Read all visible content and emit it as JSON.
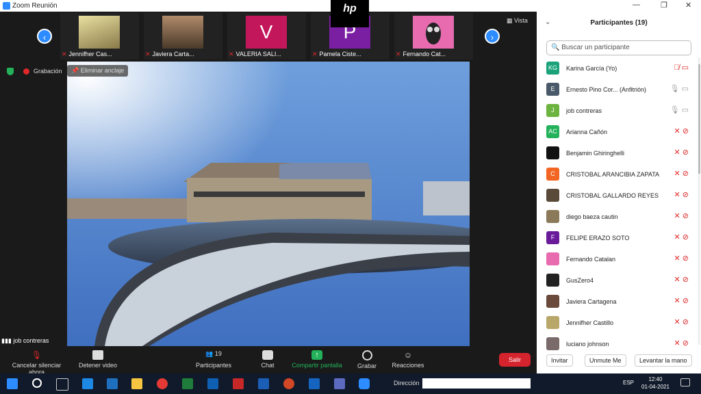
{
  "window": {
    "title": "Zoom Reunión"
  },
  "strip": {
    "view_label": "Vista",
    "thumbnails": [
      {
        "name": "Jennifher Cas...",
        "letter": "",
        "color": "#b9a76a"
      },
      {
        "name": "Javiera Carta...",
        "letter": "",
        "color": "#6a4a3a"
      },
      {
        "name": "VALERIA SALI...",
        "letter": "V",
        "color": "#c2185b"
      },
      {
        "name": "Pamela Ciste...",
        "letter": "P",
        "color": "#7b1fa2"
      },
      {
        "name": "Fernando Cat...",
        "letter": "",
        "color": "#e86bb0"
      }
    ],
    "sharing_logo": "hp"
  },
  "meeting": {
    "recording_label": "Grabación",
    "unpin_label": "Eliminar anclaje",
    "active_speaker": "job contreras"
  },
  "toolbar": {
    "mute": "Cancelar silenciar ahora",
    "video": "Detener video",
    "participants": "Participantes",
    "participants_count": "19",
    "chat": "Chat",
    "share": "Compartir pantalla",
    "record": "Grabar",
    "reactions": "Reacciones",
    "leave": "Salir"
  },
  "panel": {
    "title": "Participantes (19)",
    "search_placeholder": "Buscar un participante",
    "participants": [
      {
        "initials": "KG",
        "name": "Karina García (Yo)",
        "color": "#1aa37a",
        "mic": "muted",
        "video": "on"
      },
      {
        "initials": "E",
        "name": "Ernesto Pino Cor... (Anfitrión)",
        "color": "#4a5a6a",
        "mic": "on",
        "video": "on"
      },
      {
        "initials": "J",
        "name": "job contreras",
        "color": "#6db33f",
        "mic": "on",
        "video": "on"
      },
      {
        "initials": "AC",
        "name": "Arianna Cañón",
        "color": "#23b25b",
        "mic": "muted",
        "video": "off"
      },
      {
        "initials": "",
        "name": "Benjamin Ghiringhelli",
        "color": "#111111",
        "mic": "muted",
        "video": "off"
      },
      {
        "initials": "C",
        "name": "CRISTOBAL ARANCIBIA ZAPATA",
        "color": "#f26522",
        "mic": "muted",
        "video": "off"
      },
      {
        "initials": "",
        "name": "CRISTOBAL GALLARDO REYES",
        "color": "#5a4a3a",
        "mic": "muted",
        "video": "off"
      },
      {
        "initials": "",
        "name": "diego baeza cautin",
        "color": "#8a7a5a",
        "mic": "muted",
        "video": "off"
      },
      {
        "initials": "F",
        "name": "FELIPE ERAZO SOTO",
        "color": "#6a1b9a",
        "mic": "muted",
        "video": "off"
      },
      {
        "initials": "",
        "name": "Fernando Catalan",
        "color": "#e86bb0",
        "mic": "muted",
        "video": "off"
      },
      {
        "initials": "",
        "name": "GusZero4",
        "color": "#222222",
        "mic": "muted",
        "video": "off"
      },
      {
        "initials": "",
        "name": "Javiera Cartagena",
        "color": "#6a4a3a",
        "mic": "muted",
        "video": "off"
      },
      {
        "initials": "",
        "name": "Jennifher Castillo",
        "color": "#b9a76a",
        "mic": "muted",
        "video": "off"
      },
      {
        "initials": "",
        "name": "luciano johnson",
        "color": "#7a6a6a",
        "mic": "muted",
        "video": "off"
      }
    ],
    "invite": "Invitar",
    "unmute_me": "Unmute Me",
    "raise_hand": "Levantar la mano"
  },
  "taskbar": {
    "address_label": "Dirección",
    "language": "ESP",
    "time": "12:40",
    "date": "01-04-2021"
  }
}
